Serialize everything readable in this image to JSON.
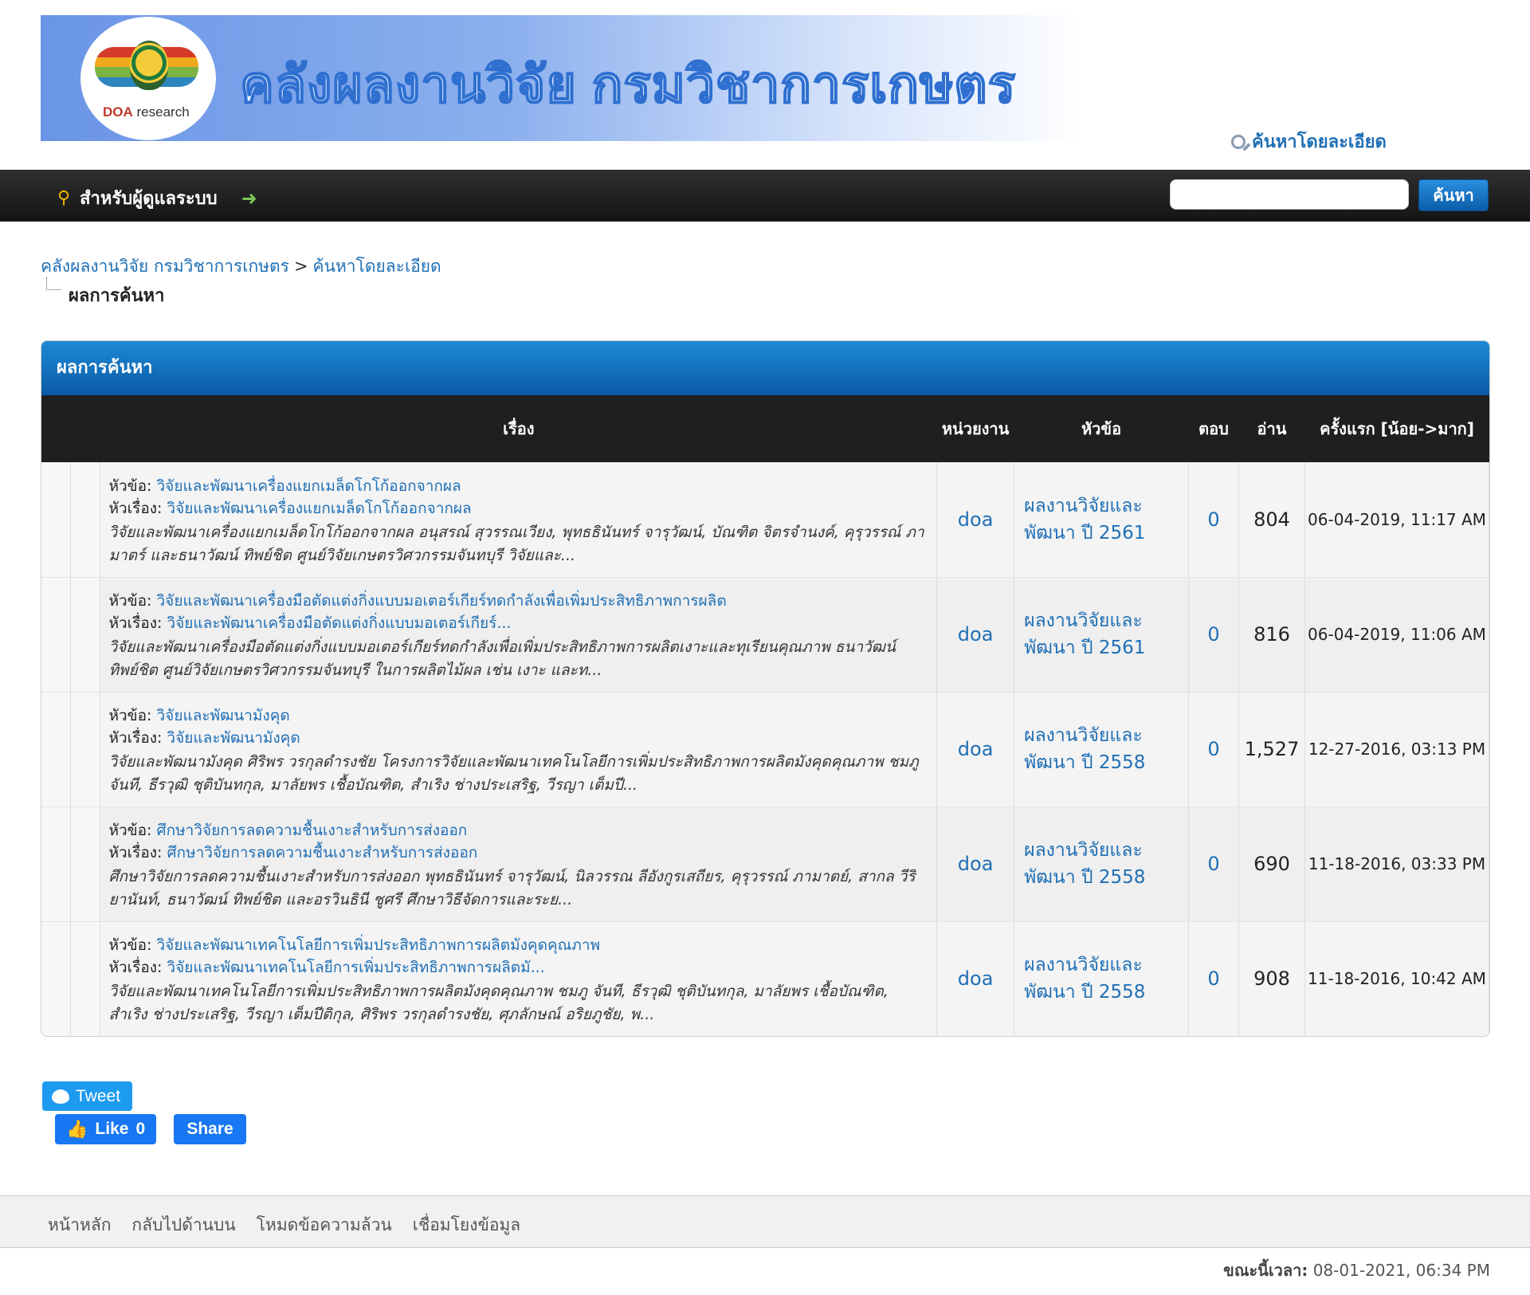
{
  "site": {
    "banner_title": "คลังผลงานวิจัย กรมวิชาการเกษตร",
    "logo_text_bold": "DOA",
    "logo_text_rest": " research",
    "advanced_search": "ค้นหาโดยละเอียด"
  },
  "navbar": {
    "admin_label": "สำหรับผู้ดูแลระบบ",
    "search_placeholder": "",
    "search_button": "ค้นหา"
  },
  "breadcrumb": {
    "home": "คลังผลงานวิจัย กรมวิชาการเกษตร",
    "separator": ">",
    "current": "ค้นหาโดยละเอียด",
    "page_title": "ผลการค้นหา"
  },
  "results": {
    "heading": "ผลการค้นหา",
    "columns": {
      "subject": "เรื่อง",
      "unit": "หน่วยงาน",
      "forum": "หัวข้อ",
      "replies": "ตอบ",
      "views": "อ่าน",
      "first_post": "ครั้งแรก [น้อย->มาก]"
    },
    "label_topic": "หัวข้อ:",
    "label_thread": "หัวเรื่อง:",
    "rows": [
      {
        "topic": "วิจัยและพัฒนาเครื่องแยกเมล็ดโกโก้ออกจากผล",
        "thread": "วิจัยและพัฒนาเครื่องแยกเมล็ดโกโก้ออกจากผล",
        "excerpt": "วิจัยและพัฒนาเครื่องแยกเมล็ดโกโก้ออกจากผล อนุสรณ์ สุวรรณเวียง, พุทธธินันทร์ จารุวัฒน์, บัณฑิต จิตรจำนงค์, คุรุวรรณ์ ภามาตร์ และธนาวัฒน์ ทิพย์ชิต ศูนย์วิจัยเกษตรวิศวกรรมจันทบุรี วิจัยและ...",
        "unit": "doa",
        "forum": "ผลงานวิจัยและพัฒนา ปี 2561",
        "replies": "0",
        "views": "804",
        "date": "06-04-2019, 11:17 AM"
      },
      {
        "topic": "วิจัยและพัฒนาเครื่องมือตัดแต่งกิ่งแบบมอเตอร์เกียร์ทดกำลังเพื่อเพิ่มประสิทธิภาพการผลิต",
        "thread": "วิจัยและพัฒนาเครื่องมือตัดแต่งกิ่งแบบมอเตอร์เกียร์...",
        "excerpt": "วิจัยและพัฒนาเครื่องมือตัดแต่งกิ่งแบบมอเตอร์เกียร์ทดกำลังเพื่อเพิ่มประสิทธิภาพการผลิตเงาะและทุเรียนคุณภาพ ธนาวัฒน์ ทิพย์ชิต ศูนย์วิจัยเกษตรวิศวกรรมจันทบุรี ในการผลิตไม้ผล เช่น เงาะ และท...",
        "unit": "doa",
        "forum": "ผลงานวิจัยและพัฒนา ปี 2561",
        "replies": "0",
        "views": "816",
        "date": "06-04-2019, 11:06 AM"
      },
      {
        "topic": "วิจัยและพัฒนามังคุด",
        "thread": "วิจัยและพัฒนามังคุด",
        "excerpt": "วิจัยและพัฒนามังคุด ศิริพร วรกุลดำรงชัย โครงการวิจัยและพัฒนาเทคโนโลยีการเพิ่มประสิทธิภาพการผลิตมังคุดคุณภาพ ชมภู จันที, ธีรวุฒิ ชุติบันทกุล, มาลัยพร เชื้อบัณฑิต, สำเริง ช่างประเสริฐ, วีรญา เต็มปี...",
        "unit": "doa",
        "forum": "ผลงานวิจัยและพัฒนา ปี 2558",
        "replies": "0",
        "views": "1,527",
        "date": "12-27-2016, 03:13 PM"
      },
      {
        "topic": "ศึกษาวิจัยการลดความชื้นเงาะสำหรับการส่งออก",
        "thread": "ศึกษาวิจัยการลดความชื้นเงาะสำหรับการส่งออก",
        "excerpt": "ศึกษาวิจัยการลดความชื้นเงาะสำหรับการส่งออก พุทธธินันทร์ จารุวัฒน์, นิลวรรณ ลีอังกูรเสถียร, คุรุวรรณ์ ภามาตย์, สากล วีริยานันท์, ธนาวัฒน์ ทิพย์ชิต และอรวินธินี ชูศรี ศึกษาวิธีจัดการและระย...",
        "unit": "doa",
        "forum": "ผลงานวิจัยและพัฒนา ปี 2558",
        "replies": "0",
        "views": "690",
        "date": "11-18-2016, 03:33 PM"
      },
      {
        "topic": "วิจัยและพัฒนาเทคโนโลยีการเพิ่มประสิทธิภาพการผลิตมังคุดคุณภาพ",
        "thread": "วิจัยและพัฒนาเทคโนโลยีการเพิ่มประสิทธิภาพการผลิตมั...",
        "excerpt": "วิจัยและพัฒนาเทคโนโลยีการเพิ่มประสิทธิภาพการผลิตมังคุดคุณภาพ ชมภู จันที, ธีรวุฒิ ชุติบันทกุล, มาลัยพร เชื้อบัณฑิต, สำเริง ช่างประเสริฐ, วีรญา เต็มปีติกุล, ศิริพร วรกุลดำรงชัย, ศุภลักษณ์ อริยภูชัย, พ...",
        "unit": "doa",
        "forum": "ผลงานวิจัยและพัฒนา ปี 2558",
        "replies": "0",
        "views": "908",
        "date": "11-18-2016, 10:42 AM"
      }
    ]
  },
  "social": {
    "tweet": "Tweet",
    "like": "Like",
    "like_count": "0",
    "share": "Share"
  },
  "footer": {
    "links": [
      "หน้าหลัก",
      "กลับไปด้านบน",
      "โหมดข้อความล้วน",
      "เชื่อมโยงข้อมูล"
    ],
    "time_label": "ขณะนี้เวลา:",
    "time_value": "08-01-2021, 06:34 PM"
  },
  "colors": {
    "link": "#1f6fb5",
    "header_blue": "#0a5aa5",
    "navbar": "#1f1f1f"
  }
}
